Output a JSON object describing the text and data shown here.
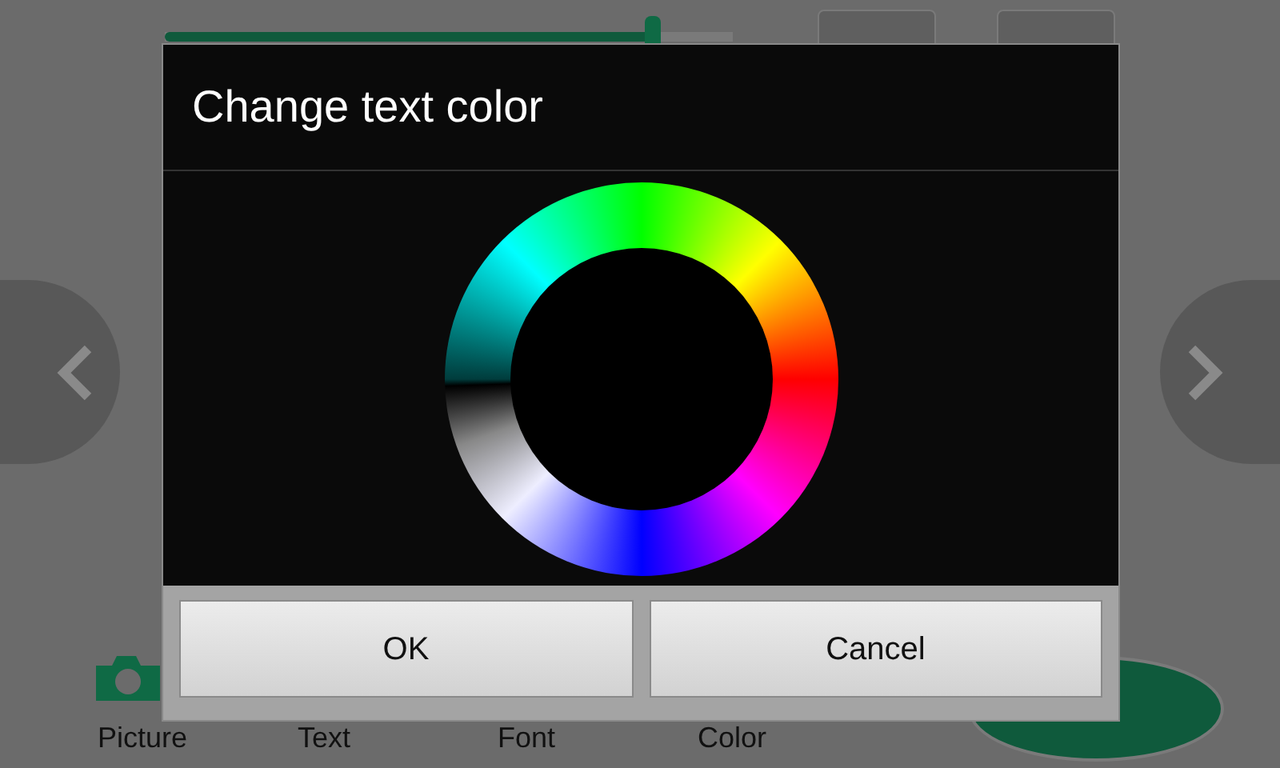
{
  "slider": {
    "level": 0.86
  },
  "bottom_bar": [
    {
      "label": "Picture",
      "kind": "camera"
    },
    {
      "label": "Text",
      "kind": "plain"
    },
    {
      "label": "Font",
      "kind": "plain"
    },
    {
      "label": "Color",
      "kind": "plain"
    }
  ],
  "dialog": {
    "title": "Change text color",
    "buttons": [
      "OK",
      "Cancel"
    ]
  }
}
